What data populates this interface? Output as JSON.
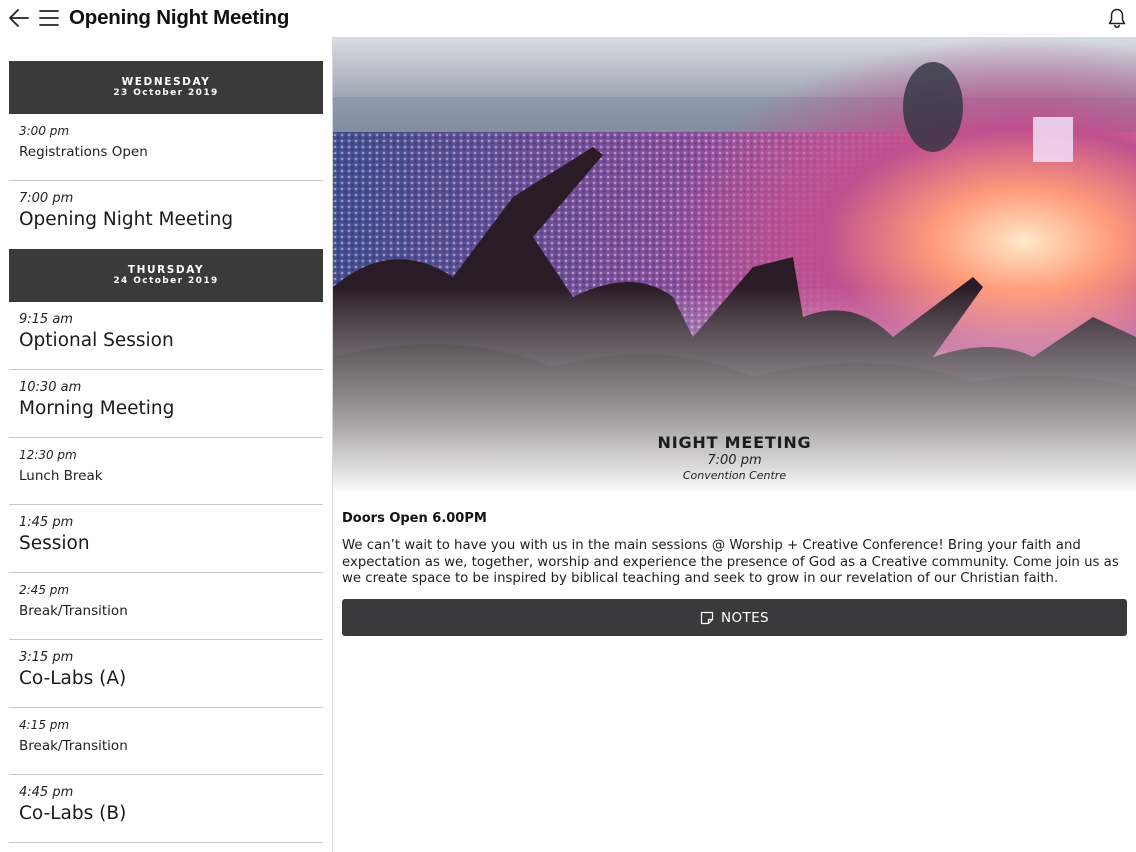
{
  "header": {
    "title": "Opening Night Meeting",
    "back_icon": "arrow-left-icon",
    "menu_icon": "hamburger-menu-icon",
    "bell_icon": "bell-icon"
  },
  "schedule": {
    "days": [
      {
        "dow": "WEDNESDAY",
        "date": "23 October 2019",
        "items": [
          {
            "time": "3:00 pm",
            "name": "Registrations Open"
          },
          {
            "time": "7:00 pm",
            "name": "Opening Night Meeting"
          }
        ]
      },
      {
        "dow": "THURSDAY",
        "date": "24 October 2019",
        "items": [
          {
            "time": "9:15 am",
            "name": "Optional Session"
          },
          {
            "time": "10:30 am",
            "name": "Morning Meeting"
          },
          {
            "time": "12:30 pm",
            "name": "Lunch Break"
          },
          {
            "time": "1:45 pm",
            "name": "Session"
          },
          {
            "time": "2:45 pm",
            "name": "Break/Transition"
          },
          {
            "time": "3:15 pm",
            "name": "Co-Labs (A)"
          },
          {
            "time": "4:15 pm",
            "name": "Break/Transition"
          },
          {
            "time": "4:45 pm",
            "name": "Co-Labs (B)"
          }
        ]
      }
    ]
  },
  "detail": {
    "hero_title": "NIGHT MEETING",
    "hero_time": "7:00 pm",
    "hero_venue": "Convention Centre",
    "doors": "Doors Open 6.00PM",
    "description": "We can’t wait to have you with us in the main sessions @ Worship + Creative Conference! Bring your faith and expectation as we, together, worship and experience the presence of God as a Creative community. Come join us as we create space to be inspired by biblical teaching and seek to grow in our revelation of our Christian faith.",
    "notes_label": "NOTES",
    "notes_icon": "note-icon"
  },
  "colors": {
    "day_header_bg": "#3a3a3a",
    "button_bg": "#3a3a3c",
    "divider": "#c8c8c8"
  }
}
